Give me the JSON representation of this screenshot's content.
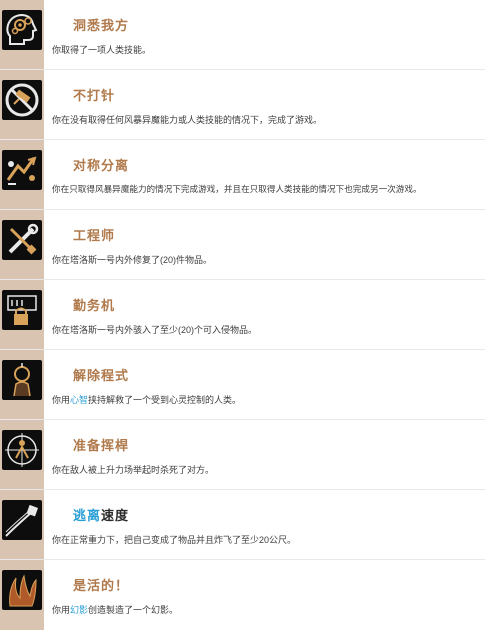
{
  "achievements": [
    {
      "icon": "brain-gears-icon",
      "title": "洞悉我方",
      "desc": "你取得了一项人类技能。"
    },
    {
      "icon": "no-syringe-icon",
      "title": "不打针",
      "desc": "你在没有取得任何风暴异魔能力或人类技能的情况下，完成了游戏。"
    },
    {
      "icon": "split-symmetry-icon",
      "title": "对称分离",
      "desc": "你在只取得风暴异魔能力的情况下完成游戏，并且在只取得人类技能的情况下也完成另一次游戏。"
    },
    {
      "icon": "wrench-screwdriver-icon",
      "title": "工程师",
      "desc": "你在塔洛斯一号内外修复了(20)件物品。"
    },
    {
      "icon": "lock-circuit-icon",
      "title": "勤务机",
      "desc": "你在塔洛斯一号内外骇入了至少(20)个可入侵物品。"
    },
    {
      "icon": "freed-mind-icon",
      "title": "解除程式",
      "desc_pre": "你用",
      "desc_hl": "心智",
      "desc_post": "挟持解救了一个受到心灵控制的人类。"
    },
    {
      "icon": "target-figure-icon",
      "title": "准备挥桿",
      "desc": "你在敌人被上升力场举起时杀死了对方。"
    },
    {
      "icon": "flying-object-icon",
      "title_hl": "逃离",
      "title_post": "速度",
      "desc": "你在正常重力下，把自己变成了物品并且炸飞了至少20公尺。"
    },
    {
      "icon": "phantom-icon",
      "title": "是活的！",
      "desc_pre": "你用",
      "desc_hl": "幻影",
      "desc_post": "创造製造了一个幻影。"
    }
  ]
}
